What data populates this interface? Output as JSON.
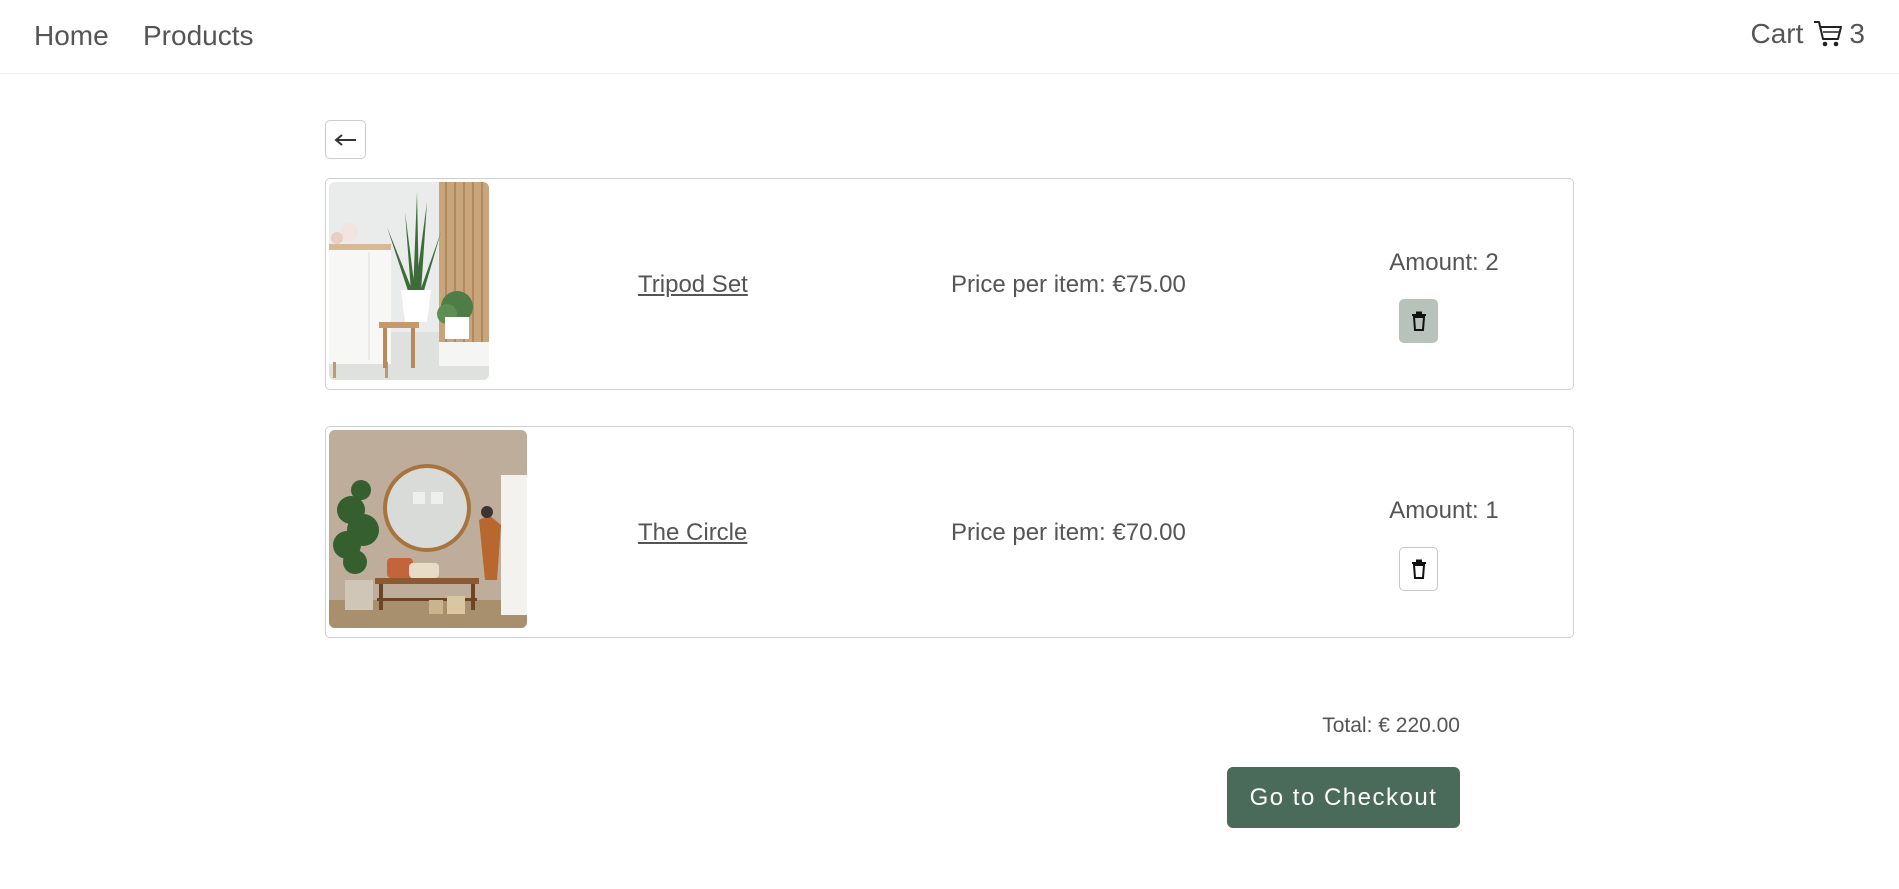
{
  "nav": {
    "home": "Home",
    "products": "Products",
    "cart_label": "Cart",
    "cart_icon": "cart-icon",
    "cart_count": "3"
  },
  "back_button": {
    "icon": "arrow-left-icon",
    "label": "←"
  },
  "cart_items": [
    {
      "name": "Tripod Set",
      "price": "Price per item: €75.00",
      "amount": "Amount: 2",
      "image": "living-room-plant-shelf-photo"
    },
    {
      "name": "The Circle",
      "price": "Price per item: €70.00",
      "amount": "Amount: 1",
      "image": "round-mirror-entryway-photo"
    }
  ],
  "delete_icon": "trash-icon",
  "total": "Total: € 220.00",
  "checkout_label": "Go to Checkout",
  "colors": {
    "accent": "#4a6b59",
    "delete_hover": "#b7c2bb",
    "text": "#555555",
    "border": "#cfcfcf"
  }
}
